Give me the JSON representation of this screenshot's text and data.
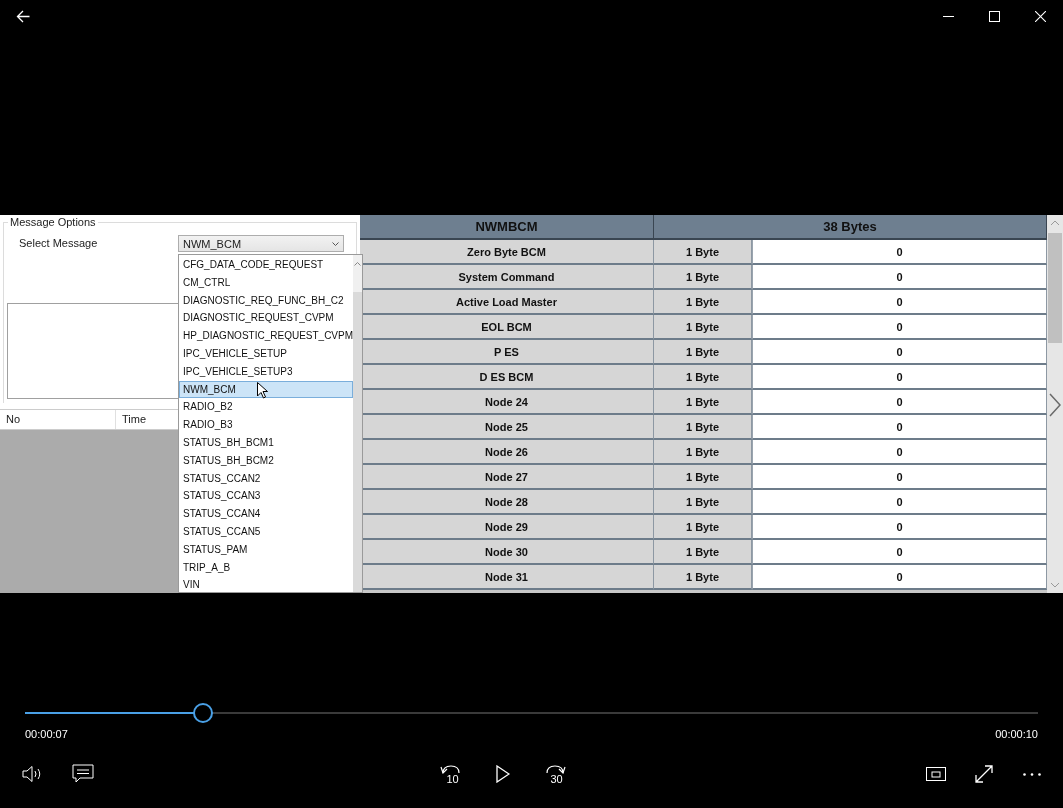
{
  "message_options": {
    "title": "Message Options",
    "select_label": "Select Message",
    "select_value": "NWM_BCM",
    "dropdown_items": [
      {
        "label": "CFG_DATA_CODE_REQUEST",
        "selected": false
      },
      {
        "label": "CM_CTRL",
        "selected": false
      },
      {
        "label": "DIAGNOSTIC_REQ_FUNC_BH_C2",
        "selected": false
      },
      {
        "label": "DIAGNOSTIC_REQUEST_CVPM",
        "selected": false
      },
      {
        "label": "HP_DIAGNOSTIC_REQUEST_CVPM",
        "selected": false
      },
      {
        "label": "IPC_VEHICLE_SETUP",
        "selected": false
      },
      {
        "label": "IPC_VEHICLE_SETUP3",
        "selected": false
      },
      {
        "label": "NWM_BCM",
        "selected": true
      },
      {
        "label": "RADIO_B2",
        "selected": false
      },
      {
        "label": "RADIO_B3",
        "selected": false
      },
      {
        "label": "STATUS_BH_BCM1",
        "selected": false
      },
      {
        "label": "STATUS_BH_BCM2",
        "selected": false
      },
      {
        "label": "STATUS_CCAN2",
        "selected": false
      },
      {
        "label": "STATUS_CCAN3",
        "selected": false
      },
      {
        "label": "STATUS_CCAN4",
        "selected": false
      },
      {
        "label": "STATUS_CCAN5",
        "selected": false
      },
      {
        "label": "STATUS_PAM",
        "selected": false
      },
      {
        "label": "TRIP_A_B",
        "selected": false
      },
      {
        "label": "VIN",
        "selected": false
      }
    ],
    "log_columns": [
      "No",
      "Time"
    ]
  },
  "data_table": {
    "columns": [
      "NWMBCM",
      "38 Bytes"
    ],
    "rows": [
      {
        "name": "Zero Byte BCM",
        "size": "1 Byte",
        "value": "0"
      },
      {
        "name": "System Command",
        "size": "1 Byte",
        "value": "0"
      },
      {
        "name": "Active Load Master",
        "size": "1 Byte",
        "value": "0"
      },
      {
        "name": "EOL BCM",
        "size": "1 Byte",
        "value": "0"
      },
      {
        "name": "P ES",
        "size": "1 Byte",
        "value": "0"
      },
      {
        "name": "D ES BCM",
        "size": "1 Byte",
        "value": "0"
      },
      {
        "name": "Node 24",
        "size": "1 Byte",
        "value": "0"
      },
      {
        "name": "Node 25",
        "size": "1 Byte",
        "value": "0"
      },
      {
        "name": "Node 26",
        "size": "1 Byte",
        "value": "0"
      },
      {
        "name": "Node 27",
        "size": "1 Byte",
        "value": "0"
      },
      {
        "name": "Node 28",
        "size": "1 Byte",
        "value": "0"
      },
      {
        "name": "Node 29",
        "size": "1 Byte",
        "value": "0"
      },
      {
        "name": "Node 30",
        "size": "1 Byte",
        "value": "0"
      },
      {
        "name": "Node 31",
        "size": "1 Byte",
        "value": "0"
      }
    ]
  },
  "player": {
    "level": 0.176,
    "elapsed": "00:00:07",
    "total": "00:00:10",
    "skip_back": "10",
    "skip_forward": "30"
  }
}
